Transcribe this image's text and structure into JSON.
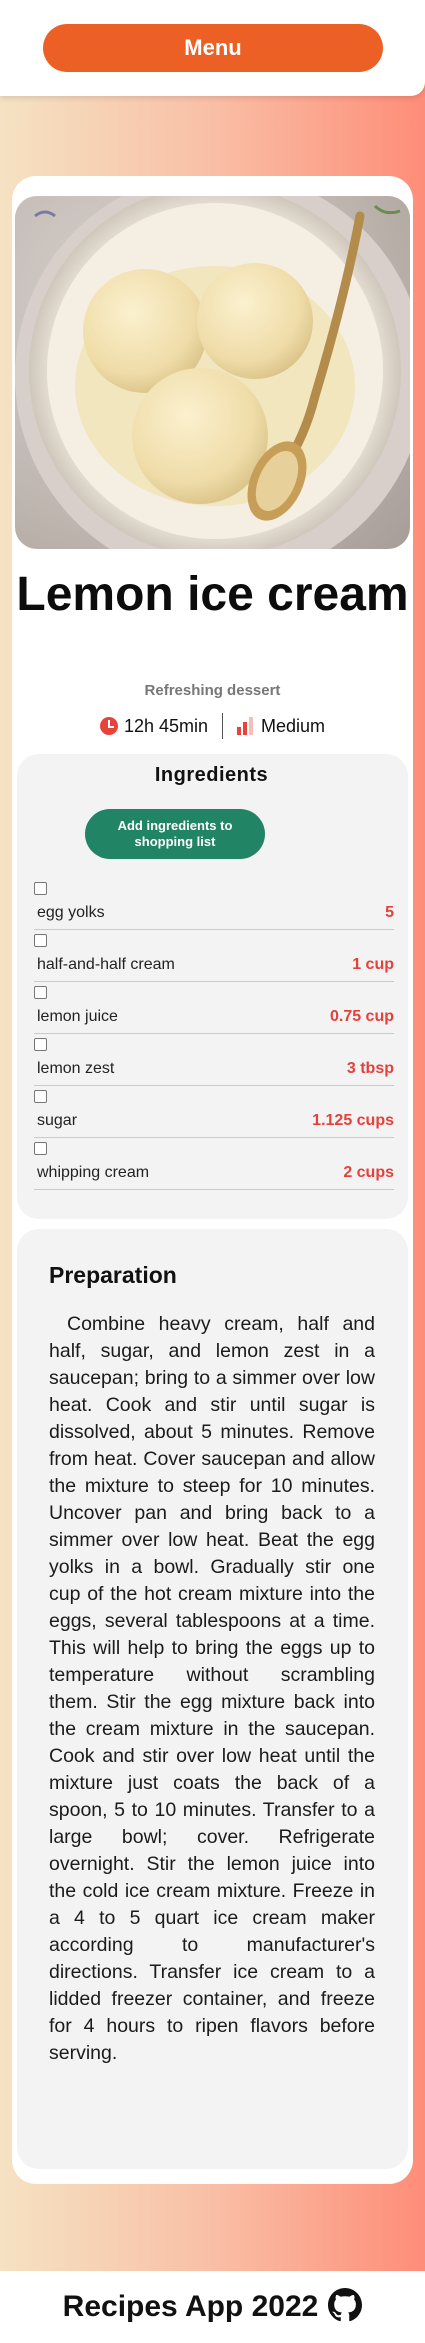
{
  "header": {
    "menu_label": "Menu"
  },
  "recipe": {
    "image_alt": "Bowl of lemon ice cream scoops with a spoon",
    "title": "Lemon ice cream",
    "subtitle": "Refreshing dessert",
    "time": "12h 45min",
    "difficulty": "Medium",
    "icons": {
      "time": "clock-icon",
      "difficulty": "bar-chart-icon"
    }
  },
  "ingredients": {
    "title": "Ingredients",
    "add_button_label": "Add ingredients to shopping list",
    "items": [
      {
        "name": "egg yolks",
        "qty": "5"
      },
      {
        "name": "half-and-half cream",
        "qty": "1 cup"
      },
      {
        "name": "lemon juice",
        "qty": "0.75 cup"
      },
      {
        "name": "lemon zest",
        "qty": "3 tbsp"
      },
      {
        "name": "sugar",
        "qty": "1.125 cups"
      },
      {
        "name": "whipping cream",
        "qty": "2 cups"
      }
    ]
  },
  "preparation": {
    "title": "Preparation",
    "text": "Combine heavy cream, half and half, sugar, and lemon zest in a saucepan; bring to a simmer over low heat. Cook and stir until sugar is dissolved, about 5 minutes. Remove from heat. Cover saucepan and allow the mixture to steep for 10 minutes. Uncover pan and bring back to a simmer over low heat. Beat the egg yolks in a bowl. Gradually stir one cup of the hot cream mixture into the eggs, several tablespoons at a time. This will help to bring the eggs up to temperature without scrambling them. Stir the egg mixture back into the cream mixture in the saucepan. Cook and stir over low heat until the mixture just coats the back of a spoon, 5 to 10 minutes. Transfer to a large bowl; cover. Refrigerate overnight. Stir the lemon juice into the cold ice cream mixture. Freeze in a 4 to 5 quart ice cream maker according to manufacturer's directions. Transfer ice cream to a lidded freezer container, and freeze for 4 hours to ripen flavors before serving."
  },
  "footer": {
    "title": "Recipes App 2022",
    "icon": "github-icon"
  },
  "colors": {
    "menu_button": "#ec5f25",
    "add_button": "#218464",
    "accent_red": "#e5413b",
    "gradient_start": "#f5e2c2",
    "gradient_end": "#fe8d78"
  }
}
